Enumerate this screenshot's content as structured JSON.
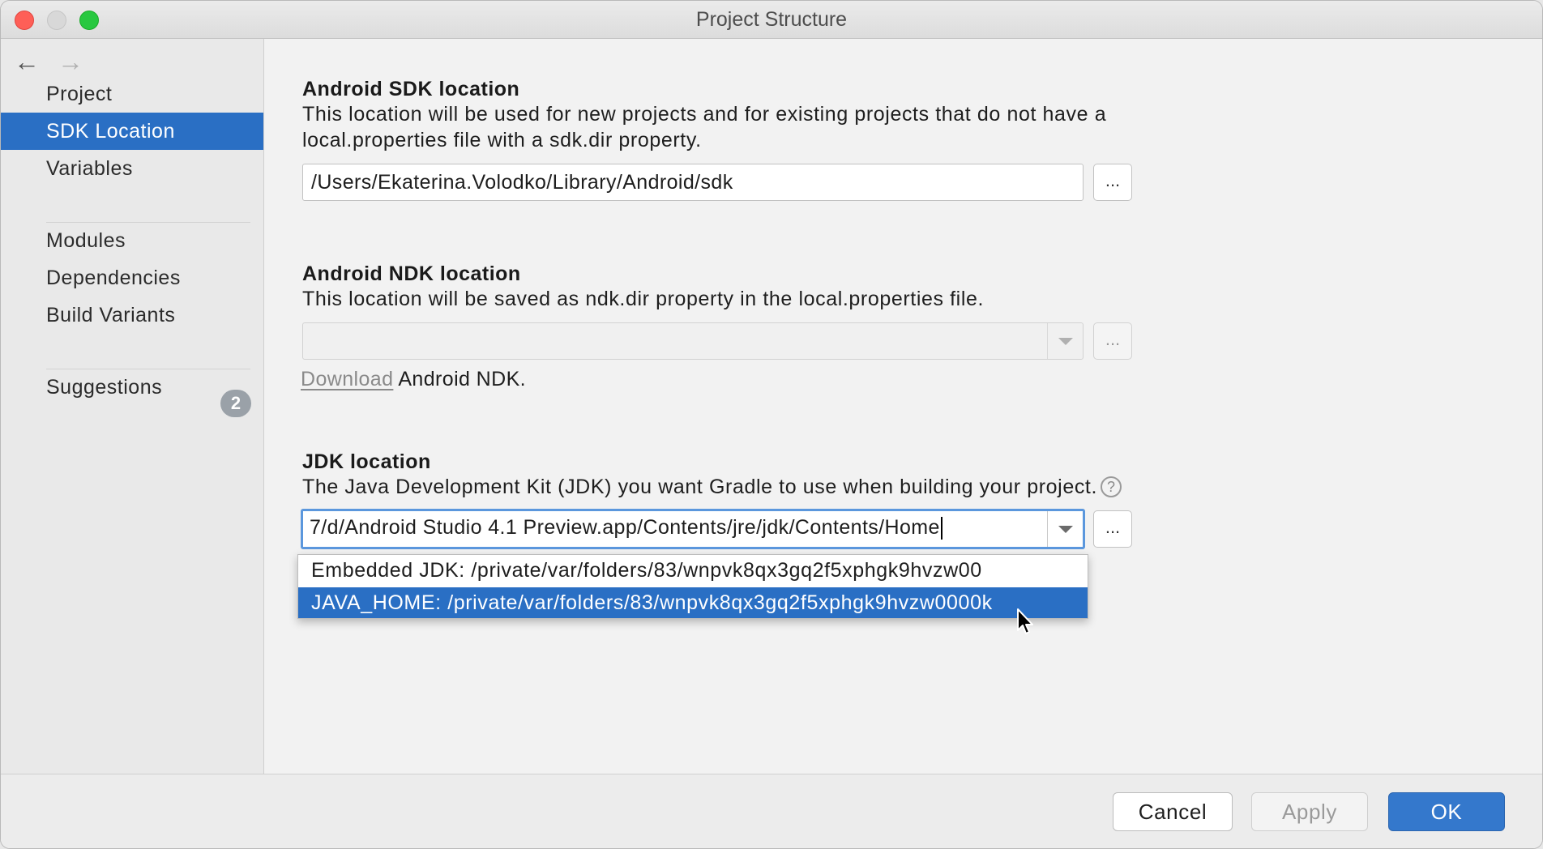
{
  "window": {
    "title": "Project Structure"
  },
  "sidebar": {
    "items": [
      {
        "label": "Project"
      },
      {
        "label": "SDK Location"
      },
      {
        "label": "Variables"
      },
      {
        "label": "Modules"
      },
      {
        "label": "Dependencies"
      },
      {
        "label": "Build Variants"
      },
      {
        "label": "Suggestions",
        "badge": "2"
      }
    ],
    "selected": "SDK Location"
  },
  "sdk": {
    "title": "Android SDK location",
    "description": "This location will be used for new projects and for existing projects that do not have a local.properties file with a sdk.dir property.",
    "value": "/Users/Ekaterina.Volodko/Library/Android/sdk",
    "browse_label": "..."
  },
  "ndk": {
    "title": "Android NDK location",
    "description": "This location will be saved as ndk.dir property in the local.properties file.",
    "value": "",
    "browse_label": "...",
    "download_link": "Download",
    "download_suffix": " Android NDK."
  },
  "jdk": {
    "title": "JDK location",
    "description": "The Java Development Kit (JDK) you want Gradle to use when building your project.",
    "help_glyph": "?",
    "value": "7/d/Android Studio 4.1 Preview.app/Contents/jre/jdk/Contents/Home",
    "browse_label": "...",
    "options": [
      {
        "label": "Embedded JDK: /private/var/folders/83/wnpvk8qx3gq2f5xphgk9hvzw00"
      },
      {
        "label": "JAVA_HOME: /private/var/folders/83/wnpvk8qx3gq2f5xphgk9hvzw0000k"
      }
    ],
    "highlighted_option": 1
  },
  "footer": {
    "cancel_label": "Cancel",
    "apply_label": "Apply",
    "ok_label": "OK"
  },
  "colors": {
    "selection": "#2a6fc4",
    "primary_button": "#3478cc",
    "focus_ring": "#5b97dd",
    "badge": "#9aa1a8"
  },
  "icons": {
    "back": "arrow-left-icon",
    "forward": "arrow-right-icon",
    "close": "close-traffic-light",
    "minimize": "minimize-traffic-light",
    "zoom": "zoom-traffic-light",
    "help": "help-icon",
    "dropdown": "chevron-down-icon",
    "cursor": "mouse-pointer-icon"
  }
}
